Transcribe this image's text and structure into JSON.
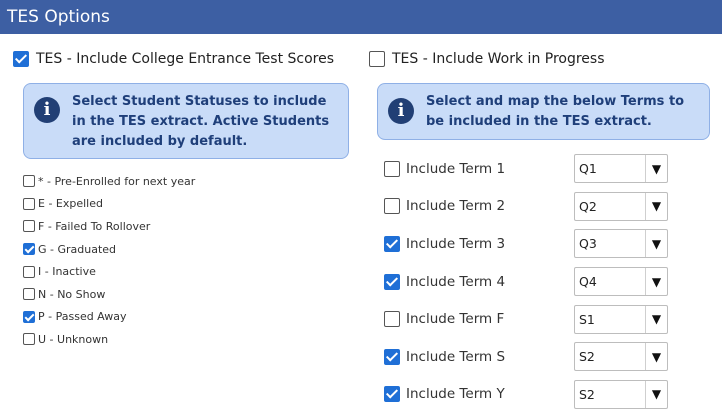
{
  "header": {
    "title": "TES Options"
  },
  "options": [
    {
      "label": "TES - Include College Entrance Test Scores",
      "checked": true
    },
    {
      "label": "TES - Include Work in Progress",
      "checked": false
    }
  ],
  "info_left": {
    "icon": "info-icon",
    "text": "Select Student Statuses to include in the TES extract. Active Students are included by default."
  },
  "info_right": {
    "icon": "info-icon",
    "text": "Select and map the below Terms to be included in the TES extract."
  },
  "statuses": [
    {
      "label": "* - Pre-Enrolled for next year",
      "checked": false
    },
    {
      "label": "E - Expelled",
      "checked": false
    },
    {
      "label": "F - Failed To Rollover",
      "checked": false
    },
    {
      "label": "G - Graduated",
      "checked": true
    },
    {
      "label": "I - Inactive",
      "checked": false
    },
    {
      "label": "N - No Show",
      "checked": false
    },
    {
      "label": "P - Passed Away",
      "checked": true
    },
    {
      "label": "U - Unknown",
      "checked": false
    }
  ],
  "terms": [
    {
      "label": "Include Term 1",
      "checked": false,
      "value": "Q1"
    },
    {
      "label": "Include Term 2",
      "checked": false,
      "value": "Q2"
    },
    {
      "label": "Include Term 3",
      "checked": true,
      "value": "Q3"
    },
    {
      "label": "Include Term 4",
      "checked": true,
      "value": "Q4"
    },
    {
      "label": "Include Term F",
      "checked": false,
      "value": "S1"
    },
    {
      "label": "Include Term S",
      "checked": true,
      "value": "S2"
    },
    {
      "label": "Include Term Y",
      "checked": true,
      "value": "S2"
    }
  ],
  "select_arrow": "▼",
  "info_glyph": "i",
  "colors": {
    "header": "#3d5fa3",
    "info_bg": "#c9dcf8",
    "checkbox": "#1f6fd6"
  }
}
